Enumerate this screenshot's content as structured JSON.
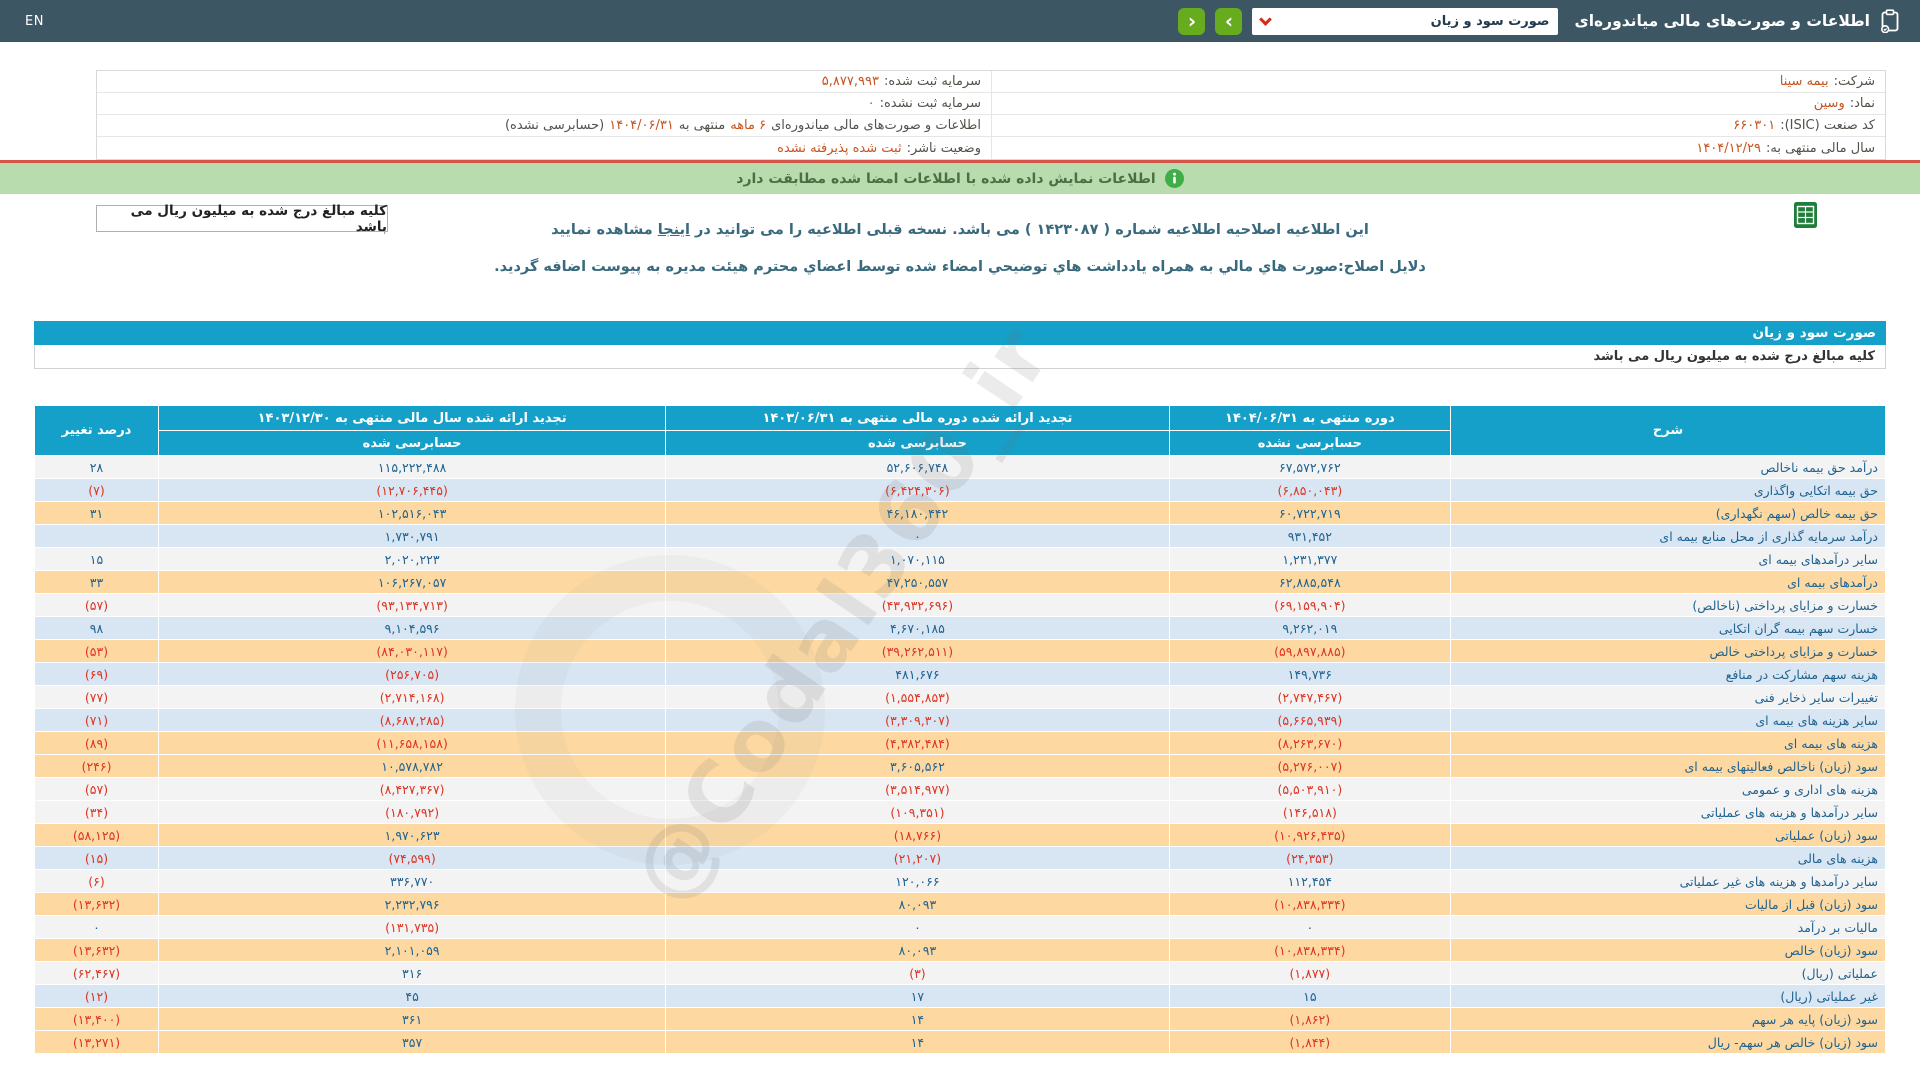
{
  "topbar": {
    "title": "اطلاعات و صورت‌های مالی میاندوره‌ای",
    "dropdown_value": "صورت سود و زیان",
    "next_label": "›",
    "prev_label": "‹",
    "en_label": "EN"
  },
  "company": {
    "right": [
      {
        "label": "شرکت:",
        "value": "بیمه سینا"
      },
      {
        "label": "نماد:",
        "value": "وسین"
      },
      {
        "label": "کد صنعت (ISIC):",
        "value": "۶۶۰۳۰۱"
      },
      {
        "label": "سال مالی منتهی به:",
        "value": "۱۴۰۴/۱۲/۲۹"
      }
    ],
    "left": [
      {
        "label": "سرمایه ثبت شده:",
        "value": "۵,۸۷۷,۹۹۳"
      },
      {
        "label": "سرمایه ثبت نشده:",
        "value": "۰"
      },
      {
        "label": "وضعیت ناشر:",
        "value": "ثبت شده پذیرفته نشده"
      }
    ],
    "period_line": {
      "t1": "اطلاعات و صورت‌های مالی میاندوره‌ای",
      "hv1": "۶ ماهه",
      "t2": "منتهی به",
      "hv2": "۱۴۰۴/۰۶/۳۱",
      "t3": "(حسابرسی نشده)"
    }
  },
  "alerts": {
    "signed_match": "اطلاعات نمایش داده شده با اطلاعات امضا شده مطابقت دارد",
    "amounts_note": "کلیه مبالغ درج شده به میلیون ریال می باشد",
    "amendment_1a": "این اطلاعیه اصلاحیه اطلاعیه شماره ( ۱۴۲۳۰۸۷ ) می باشد. نسخه قبلی اطلاعیه را می توانید در",
    "amendment_link": "اینجا",
    "amendment_1b": "مشاهده نمایید",
    "amendment_2": "دلایل اصلاح:صورت هاي مالي به همراه یادداشت هاي توضیحي امضاء شده توسط اعضاي محترم هیئت مدیره به پیوست اضافه گردید."
  },
  "section": {
    "title": "صورت سود و زیان",
    "note": "کلیه مبالغ درج شده به میلیون ریال می باشد"
  },
  "table": {
    "headers": {
      "desc": "شرح",
      "col1_title": "دوره منتهی به ۱۴۰۴/۰۶/۳۱",
      "col1_sub": "حسابرسی نشده",
      "col2_title": "تجدید ارائه شده دوره مالی منتهی به ۱۴۰۳/۰۶/۳۱",
      "col2_sub": "حسابرسی شده",
      "col3_title": "تجدید ارائه شده سال مالی منتهی به ۱۴۰۳/۱۲/۳۰",
      "col3_sub": "حسابرسی شده",
      "pct": "درصد تغییر"
    },
    "rows": [
      {
        "label": "درآمد حق بیمه ناخالص",
        "v1": "۶۷,۵۷۲,۷۶۲",
        "v2": "۵۲,۶۰۶,۷۴۸",
        "v3": "۱۱۵,۲۲۲,۴۸۸",
        "pct": "۲۸",
        "bg": "w"
      },
      {
        "label": "حق بیمه اتکایی واگذاری",
        "v1": "(۶,۸۵۰,۰۴۳)",
        "v2": "(۶,۴۲۴,۳۰۶)",
        "v3": "(۱۲,۷۰۶,۴۴۵)",
        "pct": "(۷)",
        "bg": "b"
      },
      {
        "label": "حق بیمه خالص (سهم نگهداری)",
        "v1": "۶۰,۷۲۲,۷۱۹",
        "v2": "۴۶,۱۸۰,۴۴۲",
        "v3": "۱۰۲,۵۱۶,۰۴۳",
        "pct": "۳۱",
        "bg": "o"
      },
      {
        "label": "درآمد سرمایه گذاری از محل منابع بیمه ای",
        "v1": "۹۳۱,۴۵۲",
        "v2": "۰",
        "v3": "۱,۷۳۰,۷۹۱",
        "pct": "",
        "bg": "b"
      },
      {
        "label": "سایر درآمدهای بیمه ای",
        "v1": "۱,۲۳۱,۳۷۷",
        "v2": "۱,۰۷۰,۱۱۵",
        "v3": "۲,۰۲۰,۲۲۳",
        "pct": "۱۵",
        "bg": "w"
      },
      {
        "label": "درآمدهای بیمه ای",
        "v1": "۶۲,۸۸۵,۵۴۸",
        "v2": "۴۷,۲۵۰,۵۵۷",
        "v3": "۱۰۶,۲۶۷,۰۵۷",
        "pct": "۳۳",
        "bg": "o"
      },
      {
        "label": "خسارت و مزایای پرداختی (ناخالص)",
        "v1": "(۶۹,۱۵۹,۹۰۴)",
        "v2": "(۴۳,۹۳۲,۶۹۶)",
        "v3": "(۹۳,۱۳۴,۷۱۳)",
        "pct": "(۵۷)",
        "bg": "w"
      },
      {
        "label": "خسارت سهم بیمه گران اتکایی",
        "v1": "۹,۲۶۲,۰۱۹",
        "v2": "۴,۶۷۰,۱۸۵",
        "v3": "۹,۱۰۴,۵۹۶",
        "pct": "۹۸",
        "bg": "b"
      },
      {
        "label": "خسارت و مزایای پرداختی خالص",
        "v1": "(۵۹,۸۹۷,۸۸۵)",
        "v2": "(۳۹,۲۶۲,۵۱۱)",
        "v3": "(۸۴,۰۳۰,۱۱۷)",
        "pct": "(۵۳)",
        "bg": "o"
      },
      {
        "label": "هزینه سهم مشارکت در منافع",
        "v1": "۱۴۹,۷۳۶",
        "v2": "۴۸۱,۶۷۶",
        "v3": "(۲۵۶,۷۰۵)",
        "pct": "(۶۹)",
        "bg": "b"
      },
      {
        "label": "تغییرات سایر ذخایر فنی",
        "v1": "(۲,۷۴۷,۴۶۷)",
        "v2": "(۱,۵۵۴,۸۵۳)",
        "v3": "(۲,۷۱۴,۱۶۸)",
        "pct": "(۷۷)",
        "bg": "w"
      },
      {
        "label": "سایر هزینه های بیمه ای",
        "v1": "(۵,۶۶۵,۹۳۹)",
        "v2": "(۳,۳۰۹,۳۰۷)",
        "v3": "(۸,۶۸۷,۲۸۵)",
        "pct": "(۷۱)",
        "bg": "b"
      },
      {
        "label": "هزینه های بیمه ای",
        "v1": "(۸,۲۶۳,۶۷۰)",
        "v2": "(۴,۳۸۲,۴۸۴)",
        "v3": "(۱۱,۶۵۸,۱۵۸)",
        "pct": "(۸۹)",
        "bg": "o"
      },
      {
        "label": "سود (زیان) ناخالص فعالیتهای بیمه ای",
        "v1": "(۵,۲۷۶,۰۰۷)",
        "v2": "۳,۶۰۵,۵۶۲",
        "v3": "۱۰,۵۷۸,۷۸۲",
        "pct": "(۲۴۶)",
        "bg": "o"
      },
      {
        "label": "هزینه های اداری و عمومی",
        "v1": "(۵,۵۰۳,۹۱۰)",
        "v2": "(۳,۵۱۴,۹۷۷)",
        "v3": "(۸,۴۲۷,۳۶۷)",
        "pct": "(۵۷)",
        "bg": "w"
      },
      {
        "label": "سایر درآمدها و هزینه های عملیاتی",
        "v1": "(۱۴۶,۵۱۸)",
        "v2": "(۱۰۹,۳۵۱)",
        "v3": "(۱۸۰,۷۹۲)",
        "pct": "(۳۴)",
        "bg": "w"
      },
      {
        "label": "سود (زیان) عملیاتی",
        "v1": "(۱۰,۹۲۶,۴۳۵)",
        "v2": "(۱۸,۷۶۶)",
        "v3": "۱,۹۷۰,۶۲۳",
        "pct": "(۵۸,۱۲۵)",
        "bg": "o"
      },
      {
        "label": "هزینه های مالی",
        "v1": "(۲۴,۳۵۳)",
        "v2": "(۲۱,۲۰۷)",
        "v3": "(۷۴,۵۹۹)",
        "pct": "(۱۵)",
        "bg": "b"
      },
      {
        "label": "سایر درآمدها و هزینه های غیر عملیاتی",
        "v1": "۱۱۲,۴۵۴",
        "v2": "۱۲۰,۰۶۶",
        "v3": "۳۳۶,۷۷۰",
        "pct": "(۶)",
        "bg": "w"
      },
      {
        "label": "سود (زیان) قبل از مالیات",
        "v1": "(۱۰,۸۳۸,۳۳۴)",
        "v2": "۸۰,۰۹۳",
        "v3": "۲,۲۳۲,۷۹۶",
        "pct": "(۱۳,۶۳۲)",
        "bg": "o"
      },
      {
        "label": "مالیات بر درآمد",
        "v1": "۰",
        "v2": "۰",
        "v3": "(۱۳۱,۷۳۵)",
        "pct": "۰",
        "bg": "w"
      },
      {
        "label": "سود (زیان) خالص",
        "v1": "(۱۰,۸۳۸,۳۳۴)",
        "v2": "۸۰,۰۹۳",
        "v3": "۲,۱۰۱,۰۵۹",
        "pct": "(۱۳,۶۳۲)",
        "bg": "o"
      },
      {
        "label": "عملیاتی (ریال)",
        "v1": "(۱,۸۷۷)",
        "v2": "(۳)",
        "v3": "۳۱۶",
        "pct": "(۶۲,۴۶۷)",
        "bg": "w"
      },
      {
        "label": "غیر عملیاتی (ریال)",
        "v1": "۱۵",
        "v2": "۱۷",
        "v3": "۴۵",
        "pct": "(۱۲)",
        "bg": "b"
      },
      {
        "label": "سود (زیان) پایه هر سهم",
        "v1": "(۱,۸۶۲)",
        "v2": "۱۴",
        "v3": "۳۶۱",
        "pct": "(۱۳,۴۰۰)",
        "bg": "o"
      },
      {
        "label": "سود (زیان) خالص هر سهم- ریال",
        "v1": "(۱,۸۴۴)",
        "v2": "۱۴",
        "v3": "۳۵۷",
        "pct": "(۱۳,۲۷۱)",
        "bg": "o"
      }
    ]
  },
  "watermark": "@Codal360_ir",
  "colors": {
    "topbar": "#3d5663",
    "header_blue": "#14a0c9",
    "highlight_peach": "#fdd9a1",
    "row_blue": "#d8e5f2",
    "positive_text": "#1f6391",
    "negative_text": "#de3423",
    "green_button": "#67ab1f",
    "success_bar": "#b9dcaf",
    "info_value_orange": "#c7531f",
    "divider_red": "#d6554a"
  }
}
